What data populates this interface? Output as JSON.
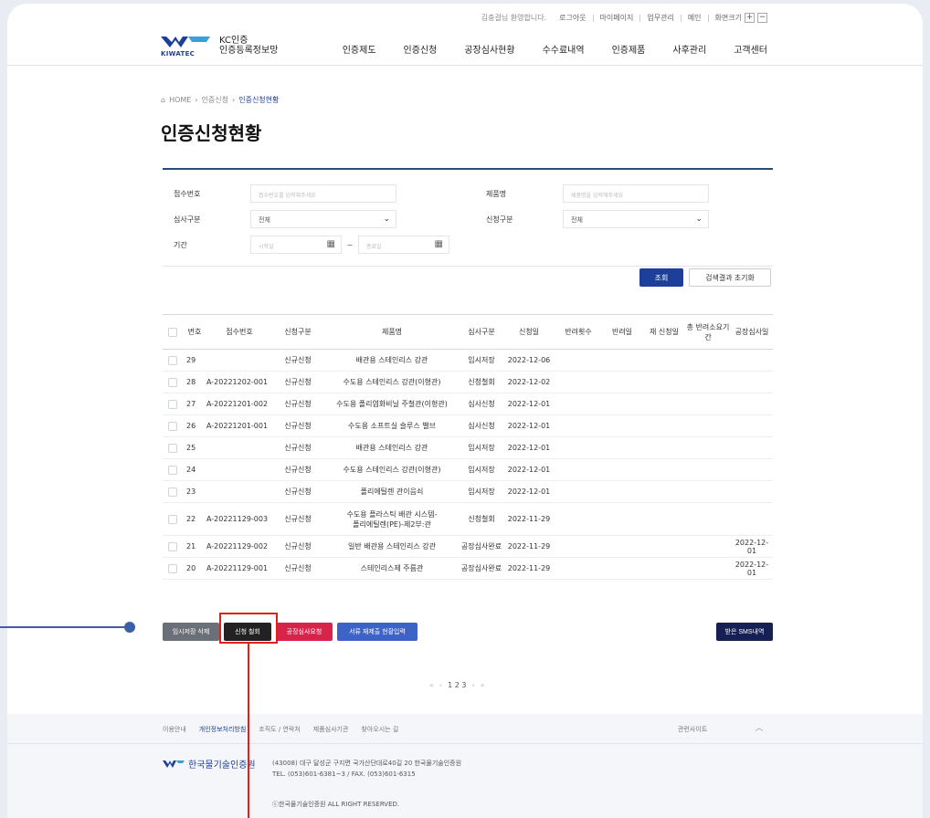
{
  "util": {
    "greeting": "김충걸님 환영합니다.",
    "links": [
      "로그아웃",
      "마이페이지",
      "업무관리",
      "메인",
      "화면크기"
    ],
    "zoom_in": "+",
    "zoom_out": "−"
  },
  "logo": {
    "brand": "KIWATEC",
    "title_line1": "KC인증",
    "title_line2": "인증등록정보망"
  },
  "nav": [
    "인증제도",
    "인증신청",
    "공장심사현황",
    "수수료내역",
    "인증제품",
    "사후관리",
    "고객센터"
  ],
  "breadcrumb": {
    "home": "HOME",
    "level1": "인증신청",
    "current": "인증신청현황"
  },
  "page_title": "인증신청현황",
  "filter": {
    "receipt_label": "접수번호",
    "receipt_placeholder": "접수번호를 입력해주세요",
    "product_label": "제품명",
    "product_placeholder": "제품명을 입력해주세요",
    "review_label": "심사구분",
    "review_value": "전체",
    "apply_label": "신청구분",
    "apply_value": "전체",
    "period_label": "기간",
    "start_placeholder": "시작일",
    "end_placeholder": "종료일",
    "tilde": "~"
  },
  "buttons": {
    "search": "조회",
    "reset": "검색결과 초기화",
    "delete_temp": "임시저장 삭제",
    "cancel_apply": "신청 철회",
    "factory_audit": "공장심사요청",
    "doc_resubmit": "서류 재제출 현황입력",
    "sms": "받은 SMS내역"
  },
  "table": {
    "headers": [
      "번호",
      "접수번호",
      "신청구분",
      "제품명",
      "심사구분",
      "신청일",
      "반려횟수",
      "반려일",
      "재 신청일",
      "총 반려소요기간",
      "공장심사일"
    ],
    "rows": [
      {
        "no": "29",
        "receipt": "",
        "type": "신규신청",
        "product": "배관용 스테인리스 강관",
        "status": "임시저장",
        "date": "2022-12-06",
        "factory": ""
      },
      {
        "no": "28",
        "receipt": "A-20221202-001",
        "type": "신규신청",
        "product": "수도용 스테인리스 강관(이형관)",
        "status": "신청철회",
        "date": "2022-12-02",
        "factory": ""
      },
      {
        "no": "27",
        "receipt": "A-20221201-002",
        "type": "신규신청",
        "product": "수도용 폴리염화비닐 주철관(이형관)",
        "status": "심사신청",
        "date": "2022-12-01",
        "factory": ""
      },
      {
        "no": "26",
        "receipt": "A-20221201-001",
        "type": "신규신청",
        "product": "수도용 소프트실 슬루스 밸브",
        "status": "심사신청",
        "date": "2022-12-01",
        "factory": ""
      },
      {
        "no": "25",
        "receipt": "",
        "type": "신규신청",
        "product": "배관용 스테인리스 강관",
        "status": "임시저장",
        "date": "2022-12-01",
        "factory": ""
      },
      {
        "no": "24",
        "receipt": "",
        "type": "신규신청",
        "product": "수도용 스테인리스 강관(이형관)",
        "status": "임시저장",
        "date": "2022-12-01",
        "factory": ""
      },
      {
        "no": "23",
        "receipt": "",
        "type": "신규신청",
        "product": "폴리에틸렌 관이음쇠",
        "status": "임시저장",
        "date": "2022-12-01",
        "factory": ""
      },
      {
        "no": "22",
        "receipt": "A-20221129-003",
        "type": "신규신청",
        "product": "수도용 플라스틱 배관 시스템-폴리에틸렌(PE)-제2부:관",
        "product_line1": "수도용 플라스틱 배관 시스템-",
        "product_line2": "폴리에틸렌(PE)-제2부:관",
        "status": "신청철회",
        "date": "2022-11-29",
        "factory": ""
      },
      {
        "no": "21",
        "receipt": "A-20221129-002",
        "type": "신규신청",
        "product": "일반 배관용 스테인리스 강관",
        "status": "공장심사완료",
        "date": "2022-11-29",
        "factory": "2022-12-01"
      },
      {
        "no": "20",
        "receipt": "A-20221129-001",
        "type": "신규신청",
        "product": "스테인리스제 주름관",
        "status": "공장심사완료",
        "date": "2022-11-29",
        "factory": "2022-12-01"
      }
    ]
  },
  "pager": {
    "first": "«",
    "prev": "‹",
    "pages": "1 2 3",
    "next": "›",
    "last": "»"
  },
  "footer": {
    "links": [
      "이용안내",
      "개인정보처리방침",
      "조직도 / 연락처",
      "제품심사기관",
      "찾아오시는 길"
    ],
    "related": "관련사이트",
    "org": "한국물기술인증원",
    "address": "(43008) 대구 달성군 구지면 국가산단대로40길 20 한국물기술인증원",
    "tel": "TEL. (053)601-6381~3 / FAX. (053)601-6315",
    "copyright": "ⓒ한국물기술인증원 ALL RIGHT RESERVED."
  },
  "colors": {
    "primary": "#1c3f9a",
    "highlight": "#e02020",
    "red_button": "#d8244b",
    "navy_button": "#162055"
  }
}
